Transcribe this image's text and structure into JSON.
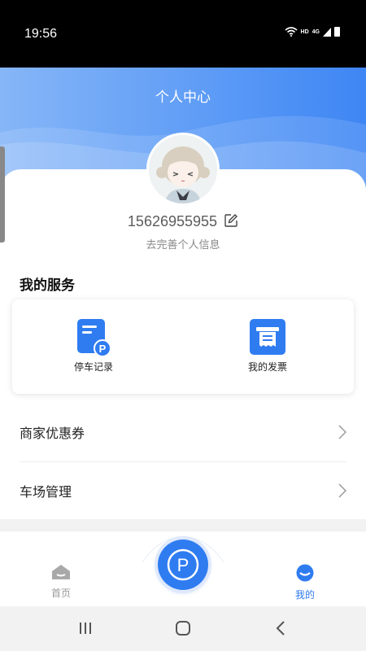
{
  "status_bar": {
    "time": "19:56",
    "network_label": "HD",
    "signal_label": "4G"
  },
  "header": {
    "title": "个人中心"
  },
  "profile": {
    "phone": "15626955955",
    "subtitle": "去完善个人信息"
  },
  "services": {
    "title": "我的服务",
    "items": [
      {
        "label": "停车记录",
        "icon": "parking-record-icon"
      },
      {
        "label": "我的发票",
        "icon": "invoice-icon"
      }
    ]
  },
  "menu": [
    {
      "label": "商家优惠券"
    },
    {
      "label": "车场管理"
    }
  ],
  "tabbar": {
    "tabs": [
      {
        "label": "首页",
        "icon": "home-icon"
      },
      {
        "label": "我的",
        "icon": "profile-icon"
      }
    ],
    "center_letter": "P"
  },
  "colors": {
    "primary": "#2f7cf1",
    "header_start": "#86b6f7",
    "header_end": "#3e86f4",
    "inactive": "#9a9a9a"
  }
}
